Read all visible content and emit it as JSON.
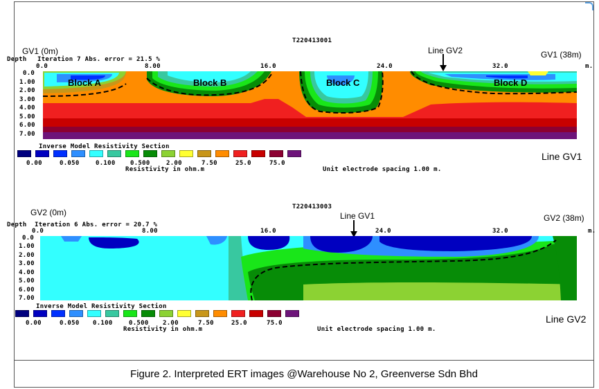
{
  "figure": {
    "caption": "Figure 2. Interpreted ERT images @Warehouse No 2, Greenverse Sdn Bhd"
  },
  "sections": [
    {
      "id": "gv1",
      "file_id": "T220413001",
      "left_label": "GV1 (0m)",
      "right_label": "GV1 (38m)",
      "depth_label": "Depth",
      "iteration_text": "Iteration 7 Abs. error = 21.5 %",
      "cross_line_label": "Line GV2",
      "line_name": "Line GV1",
      "x_ticks": [
        "0.0",
        "8.00",
        "16.0",
        "24.0",
        "32.0"
      ],
      "x_unit": "m.",
      "depth_ticks": [
        "0.0",
        "1.00",
        "2.00",
        "3.00",
        "4.00",
        "5.00",
        "6.00",
        "7.00"
      ],
      "blocks": [
        "Block A",
        "Block B",
        "Block C",
        "Block D"
      ],
      "legend_title": "Inverse Model Resistivity Section",
      "legend_values": [
        "0.00",
        "0.050",
        "0.100",
        "0.500",
        "2.00",
        "7.50",
        "25.0",
        "75.0"
      ],
      "legend_unit": "Resistivity in ohm.m",
      "electrode_text": "Unit electrode spacing 1.00 m."
    },
    {
      "id": "gv2",
      "file_id": "T220413003",
      "left_label": "GV2 (0m)",
      "right_label": "GV2 (38m)",
      "depth_label": "Depth",
      "iteration_text": "Iteration 6 Abs. error = 20.7 %",
      "cross_line_label": "Line GV1",
      "line_name": "Line GV2",
      "x_ticks": [
        "0.0",
        "8.00",
        "16.0",
        "24.0",
        "32.0"
      ],
      "x_unit": "m.",
      "depth_ticks": [
        "0.0",
        "1.00",
        "2.00",
        "3.00",
        "4.00",
        "5.00",
        "6.00",
        "7.00"
      ],
      "legend_title": "Inverse Model Resistivity Section",
      "legend_values": [
        "0.00",
        "0.050",
        "0.100",
        "0.500",
        "2.00",
        "7.50",
        "25.0",
        "75.0"
      ],
      "legend_unit": "Resistivity in ohm.m",
      "electrode_text": "Unit electrode spacing 1.00 m."
    }
  ],
  "colors": {
    "scale": [
      "#00007f",
      "#0000c0",
      "#0030ff",
      "#2e8fff",
      "#33ffff",
      "#38c8a0",
      "#19e619",
      "#078c07",
      "#8cd233",
      "#ffff33",
      "#c89619",
      "#ff8c00",
      "#f02020",
      "#c80000",
      "#8c0032",
      "#6e147a"
    ]
  }
}
